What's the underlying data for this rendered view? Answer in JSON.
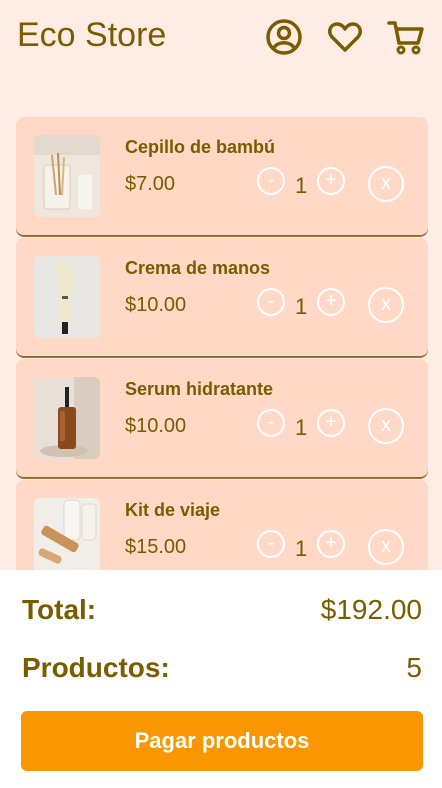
{
  "header": {
    "brand": "Eco Store",
    "icons": [
      "account-icon",
      "heart-icon",
      "cart-icon"
    ]
  },
  "colors": {
    "background": "#ffede5",
    "card": "#ffd8c6",
    "text": "#7a5c00",
    "accent": "#fa9600"
  },
  "cart": {
    "items": [
      {
        "name": "Cepillo de bambú",
        "price": "$7.00",
        "quantity": "1",
        "minus": "-",
        "plus": "+",
        "remove": "x"
      },
      {
        "name": "Crema de manos",
        "price": "$10.00",
        "quantity": "1",
        "minus": "-",
        "plus": "+",
        "remove": "x"
      },
      {
        "name": "Serum hidratante",
        "price": "$10.00",
        "quantity": "1",
        "minus": "-",
        "plus": "+",
        "remove": "x"
      },
      {
        "name": "Kit de viaje",
        "price": "$15.00",
        "quantity": "1",
        "minus": "-",
        "plus": "+",
        "remove": "x"
      }
    ]
  },
  "summary": {
    "total_label": "Total:",
    "total_value": "$192.00",
    "products_label": "Productos:",
    "products_value": "5",
    "pay_button": "Pagar productos"
  }
}
